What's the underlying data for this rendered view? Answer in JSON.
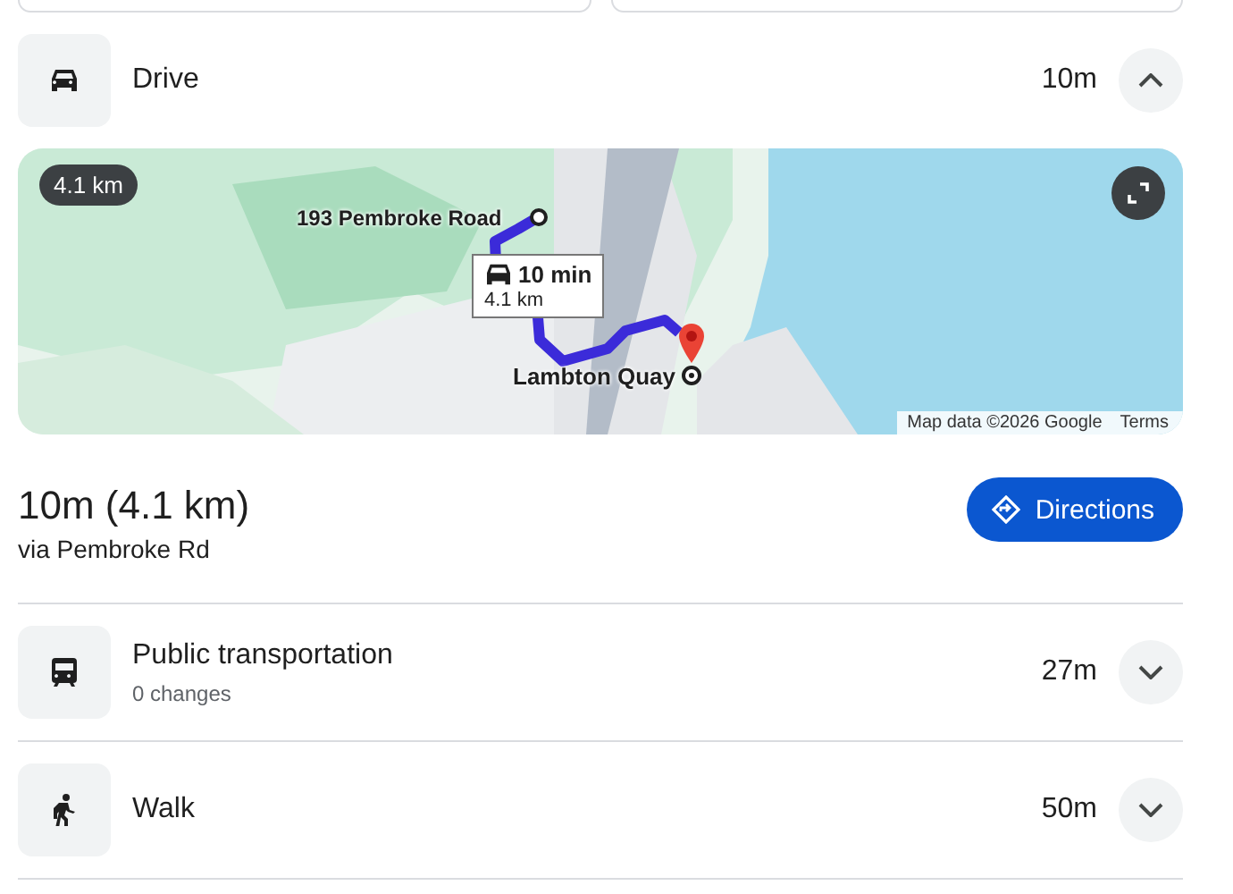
{
  "modes": [
    {
      "kind": "drive",
      "label": "Drive",
      "time": "10m",
      "expanded": true
    },
    {
      "kind": "transit",
      "label": "Public transportation",
      "subtitle": "0 changes",
      "time": "27m",
      "expanded": false
    },
    {
      "kind": "walk",
      "label": "Walk",
      "time": "50m",
      "expanded": false
    }
  ],
  "map": {
    "distance_badge": "4.1 km",
    "origin_label": "193 Pembroke Road",
    "destination_label": "Lambton Quay",
    "route_callout": {
      "time": "10 min",
      "distance": "4.1 km"
    },
    "attribution": "Map data ©2026 Google",
    "terms": "Terms"
  },
  "summary": {
    "duration": "10m (4.1 km)",
    "via": "via Pembroke Rd",
    "button": "Directions"
  }
}
